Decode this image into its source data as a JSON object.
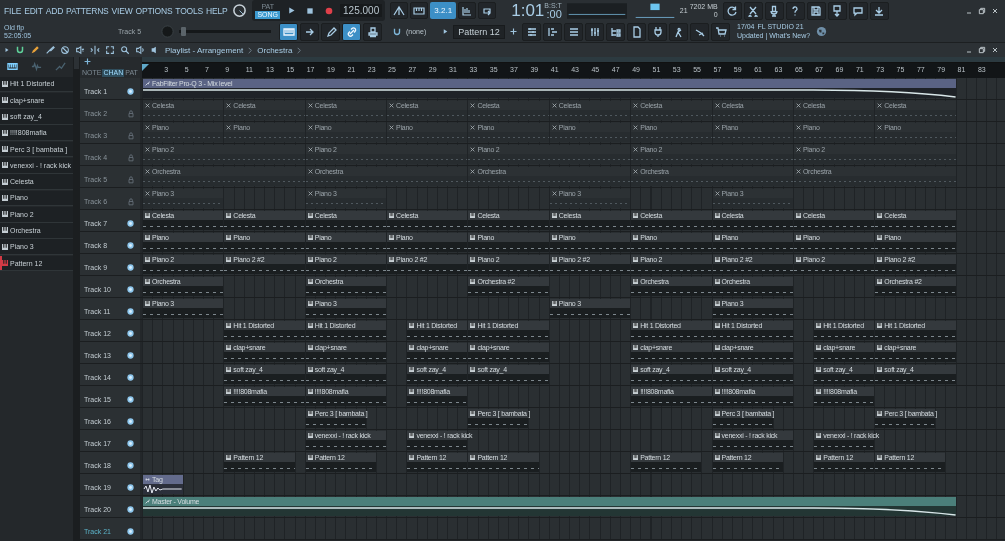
{
  "menu": [
    "FILE",
    "EDIT",
    "ADD",
    "PATTERNS",
    "VIEW",
    "OPTIONS",
    "TOOLS",
    "HELP"
  ],
  "transport": {
    "modes": [
      {
        "label": "PAT",
        "selected": false
      },
      {
        "label": "SONG",
        "selected": true
      }
    ],
    "tempo": "125.000"
  },
  "record_options": [
    {
      "on": false
    },
    {
      "on": false
    },
    {
      "label": "3.2.1",
      "on": true
    },
    {
      "on": false
    },
    {
      "on": false
    }
  ],
  "clock": {
    "time": "1:01",
    "ticks": ":00",
    "unit": "B:S:T"
  },
  "monitor": {
    "voices": "21",
    "memory": "7202 MB",
    "polyphony": "0"
  },
  "project": {
    "name": "Old flp",
    "duration": "52:05:05",
    "hint": "Track 5"
  },
  "pitch_slider": {
    "level": 0.02
  },
  "snap_tools": [
    {
      "on": true
    },
    {
      "on": false
    },
    {
      "on": false
    },
    {
      "on": true
    },
    {
      "on": false
    }
  ],
  "snap": "(none)",
  "pattern": "Pattern 12",
  "news": {
    "date": "17/04",
    "product": "FL STUDIO 21",
    "link": "Updated | What's New?"
  },
  "playlist": {
    "title": "Playlist - Arrangement",
    "crumb": "Orchestra"
  },
  "picker": {
    "tabs": [
      {
        "selected": true
      },
      {
        "selected": false
      },
      {
        "selected": false
      }
    ],
    "items": [
      {
        "name": "Hit 1 Distorted",
        "selected": false
      },
      {
        "name": "clap+snare",
        "selected": false
      },
      {
        "name": "soft zay_4",
        "selected": false
      },
      {
        "name": "!!!!808mafia",
        "selected": false
      },
      {
        "name": "Perc 3 [ bambata ]",
        "selected": false
      },
      {
        "name": "venexxi - ! rack kick",
        "selected": false
      },
      {
        "name": "Celesta",
        "selected": false
      },
      {
        "name": "Piano",
        "selected": false
      },
      {
        "name": "Piano 2",
        "selected": false
      },
      {
        "name": "Orchestra",
        "selected": false
      },
      {
        "name": "Piano 3",
        "selected": false
      },
      {
        "name": "Pattern 12",
        "selected": true
      }
    ]
  },
  "header_modes": [
    {
      "label": "NOTE",
      "selected": false
    },
    {
      "label": "CHAN",
      "selected": true
    },
    {
      "label": "PAT",
      "selected": false
    }
  ],
  "ruler": [
    "3",
    "5",
    "7",
    "9",
    "11",
    "13",
    "15",
    "17",
    "19",
    "21",
    "23",
    "25",
    "27",
    "29",
    "31",
    "33",
    "35",
    "37",
    "39",
    "41",
    "43",
    "45",
    "47",
    "49",
    "51",
    "53",
    "55",
    "57",
    "59",
    "61",
    "63",
    "65",
    "67",
    "69",
    "71",
    "73",
    "75",
    "77",
    "79",
    "81",
    "83"
  ],
  "tracks": [
    {
      "name": "Track 1",
      "locked": false,
      "selected": false,
      "clips": [
        {
          "kind": "automation",
          "name": "FabFilter Pro-Q 3 - Mix level"
        }
      ]
    },
    {
      "name": "Track 2",
      "locked": true,
      "selected": false,
      "clips": [
        {
          "kind": "pattern",
          "name": "Celesta",
          "muted": true
        },
        {
          "kind": "pattern",
          "name": "Celesta",
          "muted": true
        },
        {
          "kind": "pattern",
          "name": "Celesta",
          "muted": true
        },
        {
          "kind": "pattern",
          "name": "Celesta",
          "muted": true
        },
        {
          "kind": "pattern",
          "name": "Celesta",
          "muted": true
        },
        {
          "kind": "pattern",
          "name": "Celesta",
          "muted": true
        },
        {
          "kind": "pattern",
          "name": "Celesta",
          "muted": true
        },
        {
          "kind": "pattern",
          "name": "Celesta",
          "muted": true
        },
        {
          "kind": "pattern",
          "name": "Celesta",
          "muted": true
        },
        {
          "kind": "pattern",
          "name": "Celesta",
          "muted": true
        }
      ]
    },
    {
      "name": "Track 3",
      "locked": true,
      "selected": false,
      "clips": [
        {
          "kind": "pattern",
          "name": "Piano",
          "muted": true
        },
        {
          "kind": "pattern",
          "name": "Piano",
          "muted": true
        },
        {
          "kind": "pattern",
          "name": "Piano",
          "muted": true
        },
        {
          "kind": "pattern",
          "name": "Piano",
          "muted": true
        },
        {
          "kind": "pattern",
          "name": "Piano",
          "muted": true
        },
        {
          "kind": "pattern",
          "name": "Piano",
          "muted": true
        },
        {
          "kind": "pattern",
          "name": "Piano",
          "muted": true
        },
        {
          "kind": "pattern",
          "name": "Piano",
          "muted": true
        },
        {
          "kind": "pattern",
          "name": "Piano",
          "muted": true
        },
        {
          "kind": "pattern",
          "name": "Piano",
          "muted": true
        }
      ]
    },
    {
      "name": "Track 4",
      "locked": true,
      "selected": false,
      "clips": [
        {
          "kind": "pattern",
          "name": "Piano 2",
          "muted": true
        },
        {
          "kind": "pattern",
          "name": "Piano 2",
          "muted": true
        },
        {
          "kind": "pattern",
          "name": "Piano 2",
          "muted": true
        },
        {
          "kind": "pattern",
          "name": "Piano 2",
          "muted": true
        },
        {
          "kind": "pattern",
          "name": "Piano 2",
          "muted": true
        }
      ]
    },
    {
      "name": "Track 5",
      "locked": true,
      "selected": false,
      "clips": [
        {
          "kind": "pattern",
          "name": "Orchestra",
          "muted": true
        },
        {
          "kind": "pattern",
          "name": "Orchestra",
          "muted": true
        },
        {
          "kind": "pattern",
          "name": "Orchestra",
          "muted": true
        },
        {
          "kind": "pattern",
          "name": "Orchestra",
          "muted": true
        },
        {
          "kind": "pattern",
          "name": "Orchestra",
          "muted": true
        }
      ]
    },
    {
      "name": "Track 6",
      "locked": true,
      "selected": false,
      "clips": [
        {
          "kind": "pattern",
          "name": "Piano 3",
          "muted": true
        },
        {
          "kind": "pattern",
          "name": "Piano 3",
          "muted": true
        },
        {
          "kind": "pattern",
          "name": "Piano 3",
          "muted": true
        },
        {
          "kind": "pattern",
          "name": "Piano 3",
          "muted": true
        }
      ]
    },
    {
      "name": "Track 7",
      "locked": false,
      "selected": false,
      "clips": [
        {
          "kind": "pattern",
          "name": "Celesta",
          "muted": false
        },
        {
          "kind": "pattern",
          "name": "Celesta",
          "muted": false
        },
        {
          "kind": "pattern",
          "name": "Celesta",
          "muted": false
        },
        {
          "kind": "pattern",
          "name": "Celesta",
          "muted": false
        },
        {
          "kind": "pattern",
          "name": "Celesta",
          "muted": false
        },
        {
          "kind": "pattern",
          "name": "Celesta",
          "muted": false
        },
        {
          "kind": "pattern",
          "name": "Celesta",
          "muted": false
        },
        {
          "kind": "pattern",
          "name": "Celesta",
          "muted": false
        },
        {
          "kind": "pattern",
          "name": "Celesta",
          "muted": false
        },
        {
          "kind": "pattern",
          "name": "Celesta",
          "muted": false
        }
      ]
    },
    {
      "name": "Track 8",
      "locked": false,
      "selected": false,
      "clips": [
        {
          "kind": "pattern",
          "name": "Piano",
          "muted": false
        },
        {
          "kind": "pattern",
          "name": "Piano",
          "muted": false
        },
        {
          "kind": "pattern",
          "name": "Piano",
          "muted": false
        },
        {
          "kind": "pattern",
          "name": "Piano",
          "muted": false
        },
        {
          "kind": "pattern",
          "name": "Piano",
          "muted": false
        },
        {
          "kind": "pattern",
          "name": "Piano",
          "muted": false
        },
        {
          "kind": "pattern",
          "name": "Piano",
          "muted": false
        },
        {
          "kind": "pattern",
          "name": "Piano",
          "muted": false
        },
        {
          "kind": "pattern",
          "name": "Piano",
          "muted": false
        },
        {
          "kind": "pattern",
          "name": "Piano",
          "muted": false
        }
      ]
    },
    {
      "name": "Track 9",
      "locked": false,
      "selected": false,
      "clips": [
        {
          "kind": "pattern",
          "name": "Piano 2",
          "muted": false
        },
        {
          "kind": "pattern",
          "name": "Piano 2 #2",
          "muted": false
        },
        {
          "kind": "pattern",
          "name": "Piano 2",
          "muted": false
        },
        {
          "kind": "pattern",
          "name": "Piano 2 #2",
          "muted": false
        },
        {
          "kind": "pattern",
          "name": "Piano 2",
          "muted": false
        },
        {
          "kind": "pattern",
          "name": "Piano 2 #2",
          "muted": false
        },
        {
          "kind": "pattern",
          "name": "Piano 2",
          "muted": false
        },
        {
          "kind": "pattern",
          "name": "Piano 2 #2",
          "muted": false
        },
        {
          "kind": "pattern",
          "name": "Piano 2",
          "muted": false
        },
        {
          "kind": "pattern",
          "name": "Piano 2 #2",
          "muted": false
        }
      ]
    },
    {
      "name": "Track 10",
      "locked": false,
      "selected": false,
      "clips": [
        {
          "kind": "pattern",
          "name": "Orchestra",
          "muted": false
        },
        {
          "kind": "pattern",
          "name": "Orchestra",
          "muted": false
        },
        {
          "kind": "pattern",
          "name": "Orchestra #2",
          "muted": false
        },
        {
          "kind": "pattern",
          "name": "Orchestra",
          "muted": false
        },
        {
          "kind": "pattern",
          "name": "Orchestra",
          "muted": false
        },
        {
          "kind": "pattern",
          "name": "Orchestra #2",
          "muted": false
        }
      ]
    },
    {
      "name": "Track 11",
      "locked": false,
      "selected": false,
      "clips": [
        {
          "kind": "pattern",
          "name": "Piano 3",
          "muted": false
        },
        {
          "kind": "pattern",
          "name": "Piano 3",
          "muted": false
        },
        {
          "kind": "pattern",
          "name": "Piano 3",
          "muted": false
        },
        {
          "kind": "pattern",
          "name": "Piano 3",
          "muted": false
        }
      ]
    },
    {
      "name": "Track 12",
      "locked": false,
      "selected": false,
      "clips": [
        {
          "kind": "pattern",
          "name": "Hit 1 Distorted",
          "muted": false
        },
        {
          "kind": "pattern",
          "name": "Hit 1 Distorted",
          "muted": false
        },
        {
          "kind": "pattern",
          "name": "Hit 1 Distorted",
          "muted": false
        },
        {
          "kind": "pattern",
          "name": "Hit 1 Distorted",
          "muted": false
        },
        {
          "kind": "pattern",
          "name": "Hit 1 Distorted",
          "muted": false
        },
        {
          "kind": "pattern",
          "name": "Hit 1 Distorted",
          "muted": false
        },
        {
          "kind": "pattern",
          "name": "Hit 1 Distorted",
          "muted": false
        },
        {
          "kind": "pattern",
          "name": "Hit 1 Distorted",
          "muted": false
        }
      ]
    },
    {
      "name": "Track 13",
      "locked": false,
      "selected": false,
      "clips": [
        {
          "kind": "pattern",
          "name": "clap+snare",
          "muted": false
        },
        {
          "kind": "pattern",
          "name": "clap+snare",
          "muted": false
        },
        {
          "kind": "pattern",
          "name": "clap+snare",
          "muted": false
        },
        {
          "kind": "pattern",
          "name": "clap+snare",
          "muted": false
        },
        {
          "kind": "pattern",
          "name": "clap+snare",
          "muted": false
        },
        {
          "kind": "pattern",
          "name": "clap+snare",
          "muted": false
        },
        {
          "kind": "pattern",
          "name": "clap+snare",
          "muted": false
        },
        {
          "kind": "pattern",
          "name": "clap+snare",
          "muted": false
        }
      ]
    },
    {
      "name": "Track 14",
      "locked": false,
      "selected": false,
      "clips": [
        {
          "kind": "pattern",
          "name": "soft zay_4",
          "muted": false
        },
        {
          "kind": "pattern",
          "name": "soft zay_4",
          "muted": false
        },
        {
          "kind": "pattern",
          "name": "soft zay_4",
          "muted": false
        },
        {
          "kind": "pattern",
          "name": "soft zay_4",
          "muted": false
        },
        {
          "kind": "pattern",
          "name": "soft zay_4",
          "muted": false
        },
        {
          "kind": "pattern",
          "name": "soft zay_4",
          "muted": false
        },
        {
          "kind": "pattern",
          "name": "soft zay_4",
          "muted": false
        },
        {
          "kind": "pattern",
          "name": "soft zay_4",
          "muted": false
        }
      ]
    },
    {
      "name": "Track 15",
      "locked": false,
      "selected": false,
      "clips": [
        {
          "kind": "pattern",
          "name": "!!!!808mafia",
          "muted": false
        },
        {
          "kind": "pattern",
          "name": "!!!!808mafia",
          "muted": false
        },
        {
          "kind": "pattern",
          "name": "!!!!808mafia",
          "muted": false
        },
        {
          "kind": "pattern",
          "name": "!!!!808mafia",
          "muted": false
        },
        {
          "kind": "pattern",
          "name": "!!!!808mafia",
          "muted": false
        },
        {
          "kind": "pattern",
          "name": "!!!!808mafia",
          "muted": false
        }
      ]
    },
    {
      "name": "Track 16",
      "locked": false,
      "selected": false,
      "clips": [
        {
          "kind": "pattern",
          "name": "Perc 3 [ bambata ]",
          "muted": false
        },
        {
          "kind": "pattern",
          "name": "Perc 3 [ bambata ]",
          "muted": false
        },
        {
          "kind": "pattern",
          "name": "Perc 3 [ bambata ]",
          "muted": false
        },
        {
          "kind": "pattern",
          "name": "Perc 3 [ bambata ]",
          "muted": false
        }
      ]
    },
    {
      "name": "Track 17",
      "locked": false,
      "selected": false,
      "clips": [
        {
          "kind": "pattern",
          "name": "venexxi - ! rack kick",
          "muted": false
        },
        {
          "kind": "pattern",
          "name": "venexxi - ! rack kick",
          "muted": false
        },
        {
          "kind": "pattern",
          "name": "venexxi - ! rack kick",
          "muted": false
        },
        {
          "kind": "pattern",
          "name": "venexxi - ! rack kick",
          "muted": false
        }
      ]
    },
    {
      "name": "Track 18",
      "locked": false,
      "selected": false,
      "clips": [
        {
          "kind": "pattern",
          "name": "Pattern 12",
          "muted": false
        },
        {
          "kind": "pattern",
          "name": "Pattern 12",
          "muted": false
        },
        {
          "kind": "pattern",
          "name": "Pattern 12",
          "muted": false
        },
        {
          "kind": "pattern",
          "name": "Pattern 12",
          "muted": false
        },
        {
          "kind": "pattern",
          "name": "Pattern 12",
          "muted": false
        },
        {
          "kind": "pattern",
          "name": "Pattern 12",
          "muted": false
        },
        {
          "kind": "pattern",
          "name": "Pattern 12",
          "muted": false
        },
        {
          "kind": "pattern",
          "name": "Pattern 12",
          "muted": false
        }
      ]
    },
    {
      "name": "Track 19",
      "locked": false,
      "selected": false,
      "clips": [
        {
          "kind": "audio",
          "name": "Tag"
        }
      ]
    },
    {
      "name": "Track 20",
      "locked": false,
      "selected": false,
      "clips": [
        {
          "kind": "automation",
          "name": "Master - Volume"
        }
      ]
    },
    {
      "name": "Track 21",
      "locked": false,
      "selected": true
    }
  ]
}
